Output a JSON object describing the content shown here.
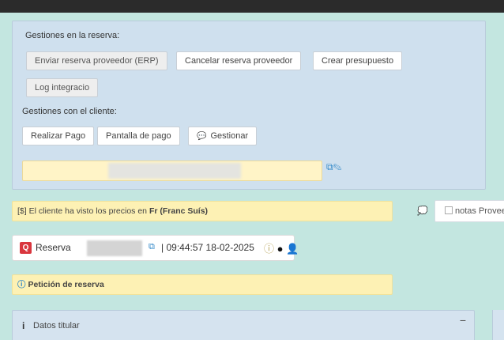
{
  "gestiones_reserva": {
    "title": "Gestiones en la reserva:",
    "buttons": {
      "enviar": "Enviar reserva proveedor (ERP)",
      "cancelar": "Cancelar reserva proveedor",
      "crear": "Crear presupuesto",
      "log": "Log integracio"
    }
  },
  "gestiones_cliente": {
    "title": "Gestiones con el cliente:",
    "buttons": {
      "pago": "Realizar Pago",
      "pantalla": "Pantalla de pago",
      "gestionar": "Gestionar"
    }
  },
  "info_bar": {
    "icon": "[$]",
    "prefix": "El cliente ha visto los precios en",
    "currency": "Fr (Franc Suís)"
  },
  "notas_proveedor": "notas Proveedor",
  "reserva": {
    "logo_letter": "Q",
    "label": "Reserva",
    "separator": "|",
    "datetime": "09:44:57 18-02-2025"
  },
  "peticion": {
    "text": "Petición de reserva"
  },
  "datos_titular": {
    "title": "Datos titular",
    "collapse": "−"
  },
  "icons": {
    "copy": "copy-icon",
    "edit": "edit-icon",
    "chat": "chat-icon",
    "info": "info-icon",
    "user": "user-icon"
  }
}
